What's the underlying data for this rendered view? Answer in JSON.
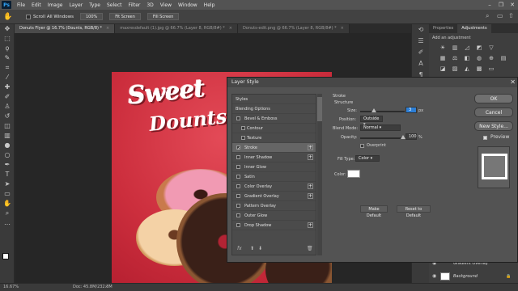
{
  "menubar": {
    "app_logo": "Ps",
    "items": [
      "File",
      "Edit",
      "Image",
      "Layer",
      "Type",
      "Select",
      "Filter",
      "3D",
      "View",
      "Window",
      "Help"
    ],
    "window_controls": [
      "–",
      "❐",
      "✕"
    ]
  },
  "options_bar": {
    "tool_icon": "hand-icon",
    "scroll_all_windows": "Scroll All Windows",
    "zoom_value": "100%",
    "fit_screen": "Fit Screen",
    "fill_screen": "Fill Screen"
  },
  "tabs": [
    {
      "label": "Donuts Flyer @ 16.7% (Dounts, RGB/8) *",
      "active": true
    },
    {
      "label": "maxresdefault (1).jpg @ 66.7% (Layer 8, RGB/8#) *",
      "active": false
    },
    {
      "label": "Donuts-edit.png @ 66.7% (Layer 8, RGB/8#) *",
      "active": false
    }
  ],
  "canvas": {
    "headline_1": "Sweet",
    "headline_2": "Dounts"
  },
  "status": {
    "zoom": "16.67%",
    "doc": "Doc: 45.8M/232.8M"
  },
  "right_panel": {
    "tabs": [
      "Properties",
      "Adjustments"
    ],
    "active_tab": "Adjustments",
    "add_adjustment": "Add an adjustment",
    "layers": [
      {
        "name": "Gradient Overlay"
      },
      {
        "name": "Background"
      }
    ]
  },
  "dialog": {
    "title": "Layer Style",
    "styles_header": "Styles",
    "blending_options": "Blending Options",
    "items": [
      {
        "label": "Bevel & Emboss",
        "checked": false,
        "plus": false,
        "level": 0
      },
      {
        "label": "Contour",
        "checked": false,
        "plus": false,
        "level": 1
      },
      {
        "label": "Texture",
        "checked": false,
        "plus": false,
        "level": 1
      },
      {
        "label": "Stroke",
        "checked": true,
        "plus": true,
        "level": 0,
        "selected": true
      },
      {
        "label": "Inner Shadow",
        "checked": false,
        "plus": true,
        "level": 0
      },
      {
        "label": "Inner Glow",
        "checked": false,
        "plus": false,
        "level": 0
      },
      {
        "label": "Satin",
        "checked": false,
        "plus": false,
        "level": 0
      },
      {
        "label": "Color Overlay",
        "checked": false,
        "plus": true,
        "level": 0
      },
      {
        "label": "Gradient Overlay",
        "checked": false,
        "plus": true,
        "level": 0
      },
      {
        "label": "Pattern Overlay",
        "checked": false,
        "plus": false,
        "level": 0
      },
      {
        "label": "Outer Glow",
        "checked": false,
        "plus": false,
        "level": 0
      },
      {
        "label": "Drop Shadow",
        "checked": false,
        "plus": true,
        "level": 0
      }
    ],
    "footer_fx": "fx",
    "stroke": {
      "heading": "Stroke",
      "structure": "Structure",
      "size_label": "Size:",
      "size_value": "3",
      "size_unit": "px",
      "size_level": 0.3,
      "position_label": "Position:",
      "position_value": "Outside",
      "blend_label": "Blend Mode:",
      "blend_value": "Normal",
      "opacity_label": "Opacity:",
      "opacity_value": "100",
      "opacity_unit": "%",
      "overprint_label": "Overprint",
      "fill_type_label": "Fill Type:",
      "fill_type_value": "Color",
      "color_label": "Color:",
      "stroke_color": "#ffffff"
    },
    "make_default": "Make Default",
    "reset_default": "Reset to Default",
    "buttons": {
      "ok": "OK",
      "cancel": "Cancel",
      "new_style": "New Style..."
    },
    "preview_label": "Preview"
  }
}
